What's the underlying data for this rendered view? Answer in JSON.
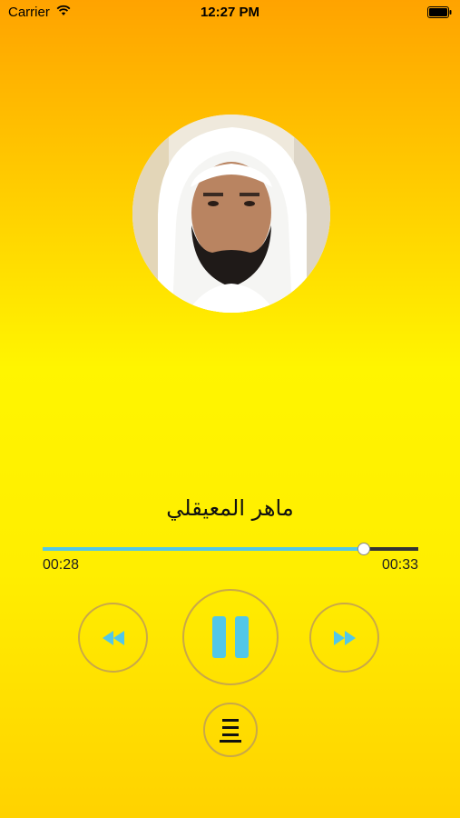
{
  "status_bar": {
    "carrier": "Carrier",
    "time": "12:27 PM",
    "icons": [
      "wifi-icon",
      "battery-icon"
    ]
  },
  "player": {
    "reciter_name": "ماهر المعيقلي",
    "elapsed": "00:28",
    "duration": "00:33",
    "progress": 0.855,
    "state": "playing"
  },
  "controls": {
    "icons": [
      "rewind-icon",
      "pause-icon",
      "fast-forward-icon",
      "playlist-icon"
    ]
  },
  "colors": {
    "accent": "#52c7e8",
    "button_border": "#c9a848",
    "track_remaining": "#333333"
  }
}
